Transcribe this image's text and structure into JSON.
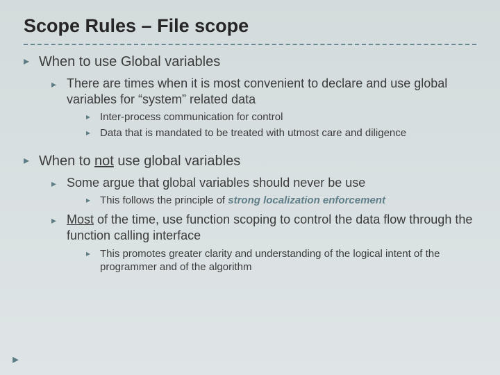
{
  "title": "Scope Rules – File scope",
  "sections": [
    {
      "heading": "When to use Global variables",
      "items": [
        {
          "text": "There are times when it is most convenient to declare and use global variables for “system” related data",
          "sub": [
            {
              "text": "Inter-process communication for control"
            },
            {
              "text": "Data that is mandated to be treated with utmost care and diligence"
            }
          ]
        }
      ]
    },
    {
      "heading_pre": "When to ",
      "heading_underline": "not",
      "heading_post": " use global variables",
      "items": [
        {
          "text": "Some argue that global variables should never be use",
          "sub": [
            {
              "text_pre": "This follows the principle of ",
              "text_em": "strong localization enforcement"
            }
          ]
        },
        {
          "text_pre_u": "Most",
          "text_post": " of the time, use function scoping to control the data flow through the function calling interface",
          "sub": [
            {
              "text": "This promotes greater clarity and understanding of the logical intent of the programmer and of the algorithm"
            }
          ]
        }
      ]
    }
  ]
}
